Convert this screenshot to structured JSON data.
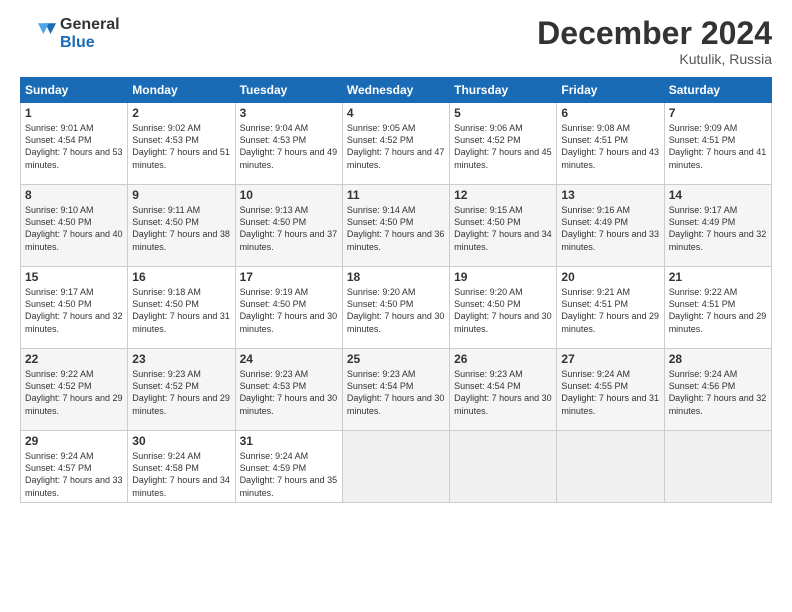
{
  "header": {
    "logo_general": "General",
    "logo_blue": "Blue",
    "month": "December 2024",
    "location": "Kutulik, Russia"
  },
  "weekdays": [
    "Sunday",
    "Monday",
    "Tuesday",
    "Wednesday",
    "Thursday",
    "Friday",
    "Saturday"
  ],
  "weeks": [
    [
      {
        "day": "1",
        "sunrise": "9:01 AM",
        "sunset": "4:54 PM",
        "daylight": "7 hours and 53 minutes."
      },
      {
        "day": "2",
        "sunrise": "9:02 AM",
        "sunset": "4:53 PM",
        "daylight": "7 hours and 51 minutes."
      },
      {
        "day": "3",
        "sunrise": "9:04 AM",
        "sunset": "4:53 PM",
        "daylight": "7 hours and 49 minutes."
      },
      {
        "day": "4",
        "sunrise": "9:05 AM",
        "sunset": "4:52 PM",
        "daylight": "7 hours and 47 minutes."
      },
      {
        "day": "5",
        "sunrise": "9:06 AM",
        "sunset": "4:52 PM",
        "daylight": "7 hours and 45 minutes."
      },
      {
        "day": "6",
        "sunrise": "9:08 AM",
        "sunset": "4:51 PM",
        "daylight": "7 hours and 43 minutes."
      },
      {
        "day": "7",
        "sunrise": "9:09 AM",
        "sunset": "4:51 PM",
        "daylight": "7 hours and 41 minutes."
      }
    ],
    [
      {
        "day": "8",
        "sunrise": "9:10 AM",
        "sunset": "4:50 PM",
        "daylight": "7 hours and 40 minutes."
      },
      {
        "day": "9",
        "sunrise": "9:11 AM",
        "sunset": "4:50 PM",
        "daylight": "7 hours and 38 minutes."
      },
      {
        "day": "10",
        "sunrise": "9:13 AM",
        "sunset": "4:50 PM",
        "daylight": "7 hours and 37 minutes."
      },
      {
        "day": "11",
        "sunrise": "9:14 AM",
        "sunset": "4:50 PM",
        "daylight": "7 hours and 36 minutes."
      },
      {
        "day": "12",
        "sunrise": "9:15 AM",
        "sunset": "4:50 PM",
        "daylight": "7 hours and 34 minutes."
      },
      {
        "day": "13",
        "sunrise": "9:16 AM",
        "sunset": "4:49 PM",
        "daylight": "7 hours and 33 minutes."
      },
      {
        "day": "14",
        "sunrise": "9:17 AM",
        "sunset": "4:49 PM",
        "daylight": "7 hours and 32 minutes."
      }
    ],
    [
      {
        "day": "15",
        "sunrise": "9:17 AM",
        "sunset": "4:50 PM",
        "daylight": "7 hours and 32 minutes."
      },
      {
        "day": "16",
        "sunrise": "9:18 AM",
        "sunset": "4:50 PM",
        "daylight": "7 hours and 31 minutes."
      },
      {
        "day": "17",
        "sunrise": "9:19 AM",
        "sunset": "4:50 PM",
        "daylight": "7 hours and 30 minutes."
      },
      {
        "day": "18",
        "sunrise": "9:20 AM",
        "sunset": "4:50 PM",
        "daylight": "7 hours and 30 minutes."
      },
      {
        "day": "19",
        "sunrise": "9:20 AM",
        "sunset": "4:50 PM",
        "daylight": "7 hours and 30 minutes."
      },
      {
        "day": "20",
        "sunrise": "9:21 AM",
        "sunset": "4:51 PM",
        "daylight": "7 hours and 29 minutes."
      },
      {
        "day": "21",
        "sunrise": "9:22 AM",
        "sunset": "4:51 PM",
        "daylight": "7 hours and 29 minutes."
      }
    ],
    [
      {
        "day": "22",
        "sunrise": "9:22 AM",
        "sunset": "4:52 PM",
        "daylight": "7 hours and 29 minutes."
      },
      {
        "day": "23",
        "sunrise": "9:23 AM",
        "sunset": "4:52 PM",
        "daylight": "7 hours and 29 minutes."
      },
      {
        "day": "24",
        "sunrise": "9:23 AM",
        "sunset": "4:53 PM",
        "daylight": "7 hours and 30 minutes."
      },
      {
        "day": "25",
        "sunrise": "9:23 AM",
        "sunset": "4:54 PM",
        "daylight": "7 hours and 30 minutes."
      },
      {
        "day": "26",
        "sunrise": "9:23 AM",
        "sunset": "4:54 PM",
        "daylight": "7 hours and 30 minutes."
      },
      {
        "day": "27",
        "sunrise": "9:24 AM",
        "sunset": "4:55 PM",
        "daylight": "7 hours and 31 minutes."
      },
      {
        "day": "28",
        "sunrise": "9:24 AM",
        "sunset": "4:56 PM",
        "daylight": "7 hours and 32 minutes."
      }
    ],
    [
      {
        "day": "29",
        "sunrise": "9:24 AM",
        "sunset": "4:57 PM",
        "daylight": "7 hours and 33 minutes."
      },
      {
        "day": "30",
        "sunrise": "9:24 AM",
        "sunset": "4:58 PM",
        "daylight": "7 hours and 34 minutes."
      },
      {
        "day": "31",
        "sunrise": "9:24 AM",
        "sunset": "4:59 PM",
        "daylight": "7 hours and 35 minutes."
      },
      null,
      null,
      null,
      null
    ]
  ],
  "labels": {
    "sunrise": "Sunrise:",
    "sunset": "Sunset:",
    "daylight": "Daylight:"
  }
}
